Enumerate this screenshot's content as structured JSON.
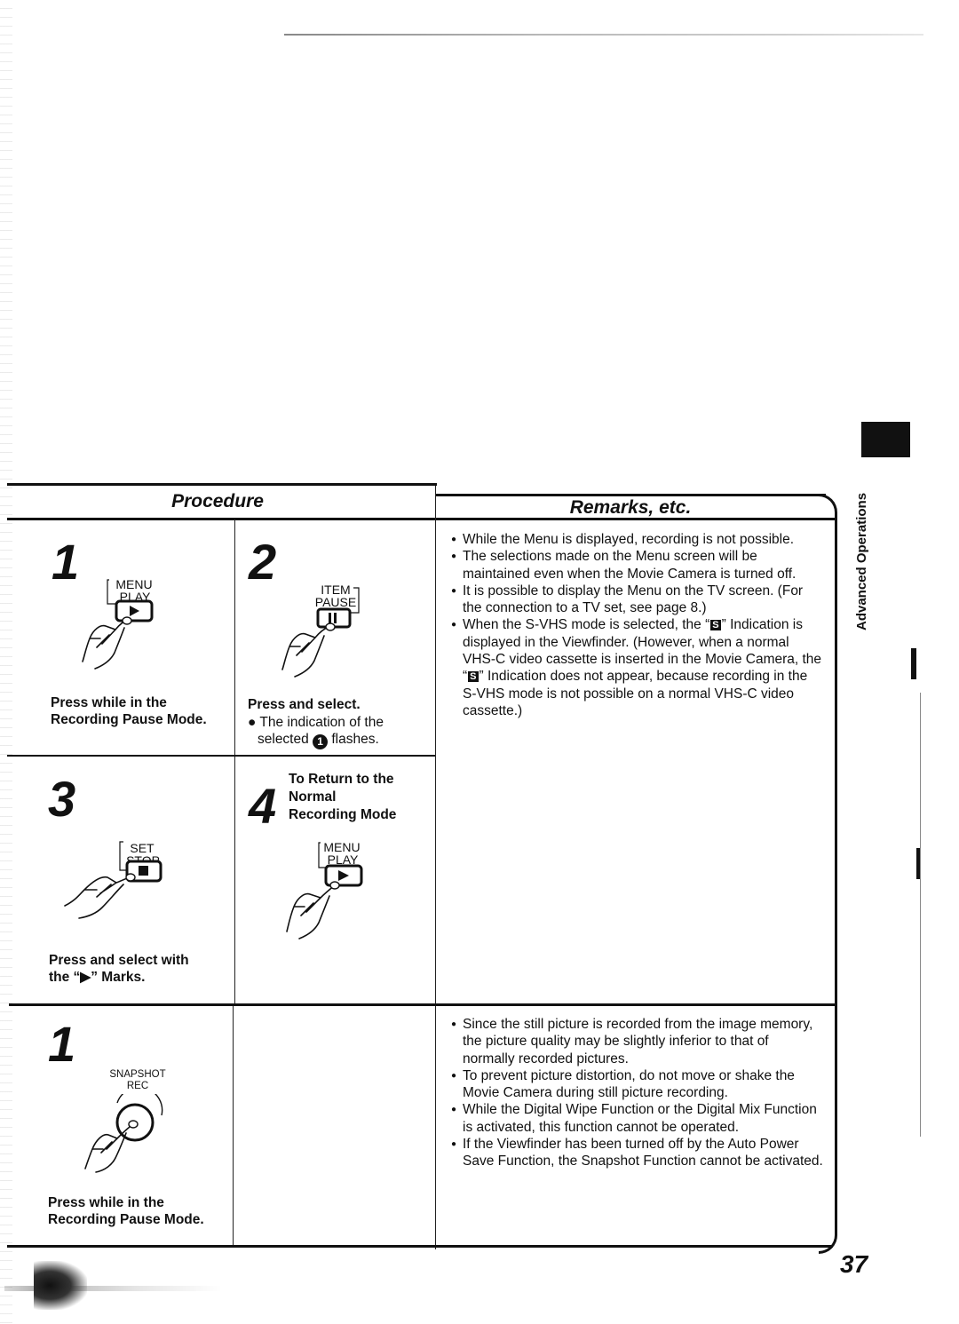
{
  "page": {
    "number": "37",
    "side_tab": "Advanced Operations"
  },
  "headers": {
    "procedure": "Procedure",
    "remarks": "Remarks, etc."
  },
  "section_menu": {
    "steps": [
      {
        "number": "1",
        "button_top_label": "MENU",
        "button_bottom_label": "PLAY",
        "button_icon": "play-icon",
        "caption_line1": "Press while in the",
        "caption_line2": "Recording Pause Mode."
      },
      {
        "number": "2",
        "button_top_label": "ITEM",
        "button_bottom_label": "PAUSE",
        "button_icon": "pause-icon",
        "caption_line1": "Press and select.",
        "note_prefix": "The indication of the",
        "note_selected": "selected",
        "note_circled": "1",
        "note_suffix": "flashes."
      },
      {
        "number": "3",
        "button_top_label": "SET",
        "button_bottom_label": "STOP",
        "button_icon": "stop-icon",
        "caption_line1": "Press and select with",
        "caption_line2": "the “▶” Marks."
      },
      {
        "number": "4",
        "heading_line1": "To Return to the",
        "heading_line2": "Normal",
        "heading_line3": "Recording Mode",
        "button_top_label": "MENU",
        "button_bottom_label": "PLAY",
        "button_icon": "play-icon"
      }
    ],
    "remarks": [
      "While the Menu is displayed, recording is not possible.",
      "The selections made on the Menu screen will be maintained even when the Movie Camera is turned off.",
      "It is possible to display the Menu on the TV screen. (For the connection to a TV set, see page 8.)",
      {
        "part1": "When the S-VHS mode is selected, the “",
        "icon": "S",
        "part2": "” Indication is displayed in the Viewfinder. (However, when a normal VHS-C video cassette is inserted in the Movie Camera, the “",
        "part3": "” Indication does not appear, because recording in the S-VHS mode is not possible on a normal VHS-C video cassette.)"
      }
    ]
  },
  "section_snapshot": {
    "step": {
      "number": "1",
      "button_top_label": "SNAPSHOT",
      "button_bottom_label": "REC",
      "button_icon": "round-record-button-icon",
      "caption_line1": "Press while in the",
      "caption_line2": "Recording Pause Mode."
    },
    "remarks": [
      "Since the still picture is recorded from the image memory, the picture quality may be slightly inferior to that of normally recorded pictures.",
      "To prevent picture distortion, do not move or shake the Movie Camera during still picture recording.",
      "While the Digital Wipe Function or the Digital Mix Function is activated, this function cannot be operated.",
      "If the Viewfinder has been turned off by the Auto Power Save Function, the Snapshot Function cannot be activated."
    ]
  }
}
